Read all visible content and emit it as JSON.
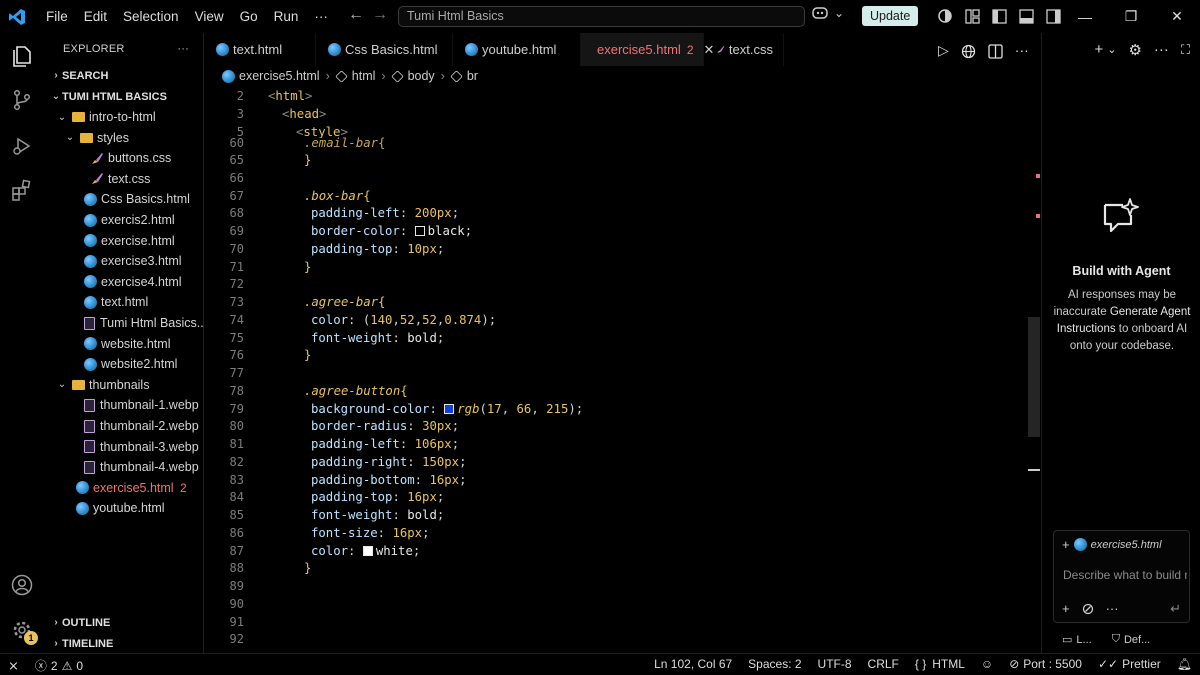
{
  "titlebar": {
    "menu": [
      "File",
      "Edit",
      "Selection",
      "View",
      "Go",
      "Run",
      "···"
    ],
    "search_text": "Tumi Html Basics",
    "update_label": "Update"
  },
  "sidebar": {
    "title": "EXPLORER",
    "more": "···",
    "search_section": "SEARCH",
    "workspace": "TUMI HTML BASICS",
    "tree": [
      {
        "label": "intro-to-html",
        "type": "folder",
        "depth": 1
      },
      {
        "label": "styles",
        "type": "folder",
        "depth": 2
      },
      {
        "label": "buttons.css",
        "type": "css",
        "depth": 3
      },
      {
        "label": "text.css",
        "type": "css",
        "depth": 3
      },
      {
        "label": "Css Basics.html",
        "type": "html",
        "depth": 2
      },
      {
        "label": "exercis2.html",
        "type": "html",
        "depth": 2
      },
      {
        "label": "exercise.html",
        "type": "html",
        "depth": 2
      },
      {
        "label": "exercise3.html",
        "type": "html",
        "depth": 2
      },
      {
        "label": "exercise4.html",
        "type": "html",
        "depth": 2
      },
      {
        "label": "text.html",
        "type": "html",
        "depth": 2
      },
      {
        "label": "Tumi Html Basics...",
        "type": "file",
        "depth": 2
      },
      {
        "label": "website.html",
        "type": "html",
        "depth": 2
      },
      {
        "label": "website2.html",
        "type": "html",
        "depth": 2
      },
      {
        "label": "thumbnails",
        "type": "folder",
        "depth": 1
      },
      {
        "label": "thumbnail-1.webp",
        "type": "file",
        "depth": 2
      },
      {
        "label": "thumbnail-2.webp",
        "type": "file",
        "depth": 2
      },
      {
        "label": "thumbnail-3.webp",
        "type": "file",
        "depth": 2
      },
      {
        "label": "thumbnail-4.webp",
        "type": "file",
        "depth": 2
      },
      {
        "label": "exercise5.html",
        "type": "html",
        "depth": 1,
        "errors": "2"
      },
      {
        "label": "youtube.html",
        "type": "html",
        "depth": 1
      }
    ],
    "outline": "OUTLINE",
    "timeline": "TIMELINE"
  },
  "tabs": [
    {
      "label": "text.html",
      "icon": "globe"
    },
    {
      "label": "Css Basics.html",
      "icon": "globe"
    },
    {
      "label": "youtube.html",
      "icon": "globe"
    },
    {
      "label": "exercise5.html",
      "icon": "globe",
      "active": true,
      "dirty": "2"
    },
    {
      "label": "text.css",
      "icon": "css"
    }
  ],
  "breadcrumb": [
    "exercise5.html",
    "html",
    "body",
    "br"
  ],
  "editor": {
    "sticky": [
      {
        "n": "2",
        "text": "<html>"
      },
      {
        "n": "3",
        "text": "<head>"
      },
      {
        "n": "5",
        "text": "<style>"
      }
    ],
    "lines": [
      {
        "n": "60",
        "text": ".email-bar{"
      },
      {
        "n": "65",
        "text": "}"
      },
      {
        "n": "66",
        "text": ""
      },
      {
        "n": "67",
        "text": ".box-bar{"
      },
      {
        "n": "68",
        "text": "padding-left: 200px;"
      },
      {
        "n": "69",
        "text": "border-color: black;"
      },
      {
        "n": "70",
        "text": "padding-top: 10px;"
      },
      {
        "n": "71",
        "text": "}"
      },
      {
        "n": "72",
        "text": ""
      },
      {
        "n": "73",
        "text": ".agree-bar{"
      },
      {
        "n": "74",
        "text": "color: (140,52,52,0.874);"
      },
      {
        "n": "75",
        "text": "font-weight: bold;"
      },
      {
        "n": "76",
        "text": "}"
      },
      {
        "n": "77",
        "text": ""
      },
      {
        "n": "78",
        "text": ".agree-button{"
      },
      {
        "n": "79",
        "text": "background-color: rgb(17, 66, 215);"
      },
      {
        "n": "80",
        "text": "border-radius: 30px;"
      },
      {
        "n": "81",
        "text": "padding-left: 106px;"
      },
      {
        "n": "82",
        "text": "padding-right: 150px;"
      },
      {
        "n": "83",
        "text": "padding-bottom: 16px;"
      },
      {
        "n": "84",
        "text": "padding-top: 16px;"
      },
      {
        "n": "85",
        "text": "font-weight: bold;"
      },
      {
        "n": "86",
        "text": "font-size: 16px;"
      },
      {
        "n": "87",
        "text": "color: white;"
      },
      {
        "n": "88",
        "text": "}"
      },
      {
        "n": "89",
        "text": ""
      },
      {
        "n": "90",
        "text": ""
      },
      {
        "n": "91",
        "text": ""
      },
      {
        "n": "92",
        "text": ""
      }
    ]
  },
  "agent": {
    "title": "Build with Agent",
    "desc1": "AI responses may be inaccurate",
    "link": "Generate Agent Instructions",
    "desc2": "to onboard AI onto your codebase.",
    "context_file": "exercise5.html",
    "input_placeholder": "Describe what to build next",
    "foot_left": "L...",
    "foot_right": "Def..."
  },
  "statusbar": {
    "errors": "2",
    "warnings": "0",
    "position": "Ln 102, Col 67",
    "spaces": "Spaces: 2",
    "encoding": "UTF-8",
    "eol": "CRLF",
    "language": "HTML",
    "port": "Port : 5500",
    "prettier": "Prettier"
  },
  "colors": {
    "accent_error": "#f07474",
    "agree_button_swatch": "#1142d7"
  },
  "settings_badge": "1"
}
